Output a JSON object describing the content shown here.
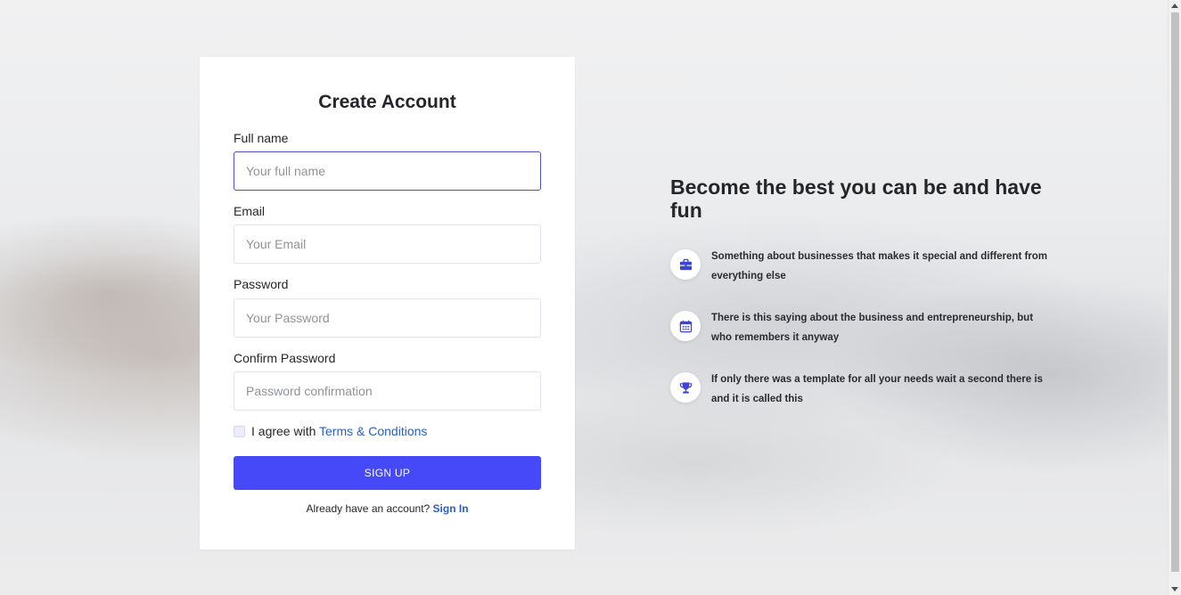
{
  "form": {
    "title": "Create Account",
    "full_name": {
      "label": "Full name",
      "placeholder": "Your full name"
    },
    "email": {
      "label": "Email",
      "placeholder": "Your Email"
    },
    "password": {
      "label": "Password",
      "placeholder": "Your Password"
    },
    "confirm_password": {
      "label": "Confirm Password",
      "placeholder": "Password confirmation"
    },
    "agree": {
      "text": "I agree with ",
      "link": "Terms & Conditions"
    },
    "submit_label": "SIGN UP",
    "signin": {
      "text": "Already have an account?",
      "link": "Sign In"
    }
  },
  "hero": {
    "title": "Become the best you can be and have fun",
    "features": [
      {
        "icon": "briefcase-icon",
        "text": "Something about businesses that makes it special and different from everything else"
      },
      {
        "icon": "calendar-icon",
        "text": "There is this saying about the business and entrepreneurship, but who remembers it anyway"
      },
      {
        "icon": "trophy-icon",
        "text": "If only there was a template for all your needs wait a second there is and it is called this"
      }
    ]
  },
  "colors": {
    "accent": "#4549f7",
    "link": "#2a5fc7",
    "icon": "#3d45d6"
  }
}
